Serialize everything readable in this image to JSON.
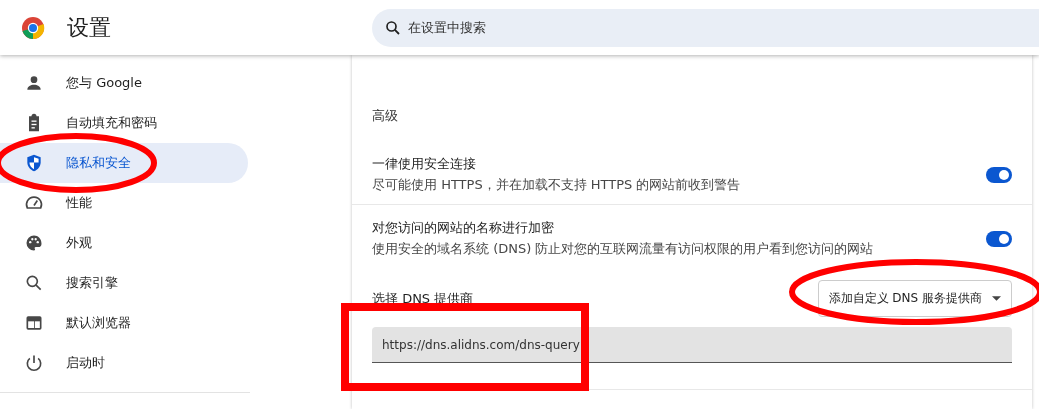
{
  "header": {
    "title": "设置",
    "search": {
      "placeholder": "在设置中搜索"
    }
  },
  "sidebar": {
    "items": [
      {
        "label": "您与 Google",
        "selected": false
      },
      {
        "label": "自动填充和密码",
        "selected": false
      },
      {
        "label": "隐私和安全",
        "selected": true
      },
      {
        "label": "性能",
        "selected": false
      },
      {
        "label": "外观",
        "selected": false
      },
      {
        "label": "搜索引擎",
        "selected": false
      },
      {
        "label": "默认浏览器",
        "selected": false
      },
      {
        "label": "启动时",
        "selected": false
      }
    ]
  },
  "content": {
    "section_title": "高级",
    "settings": [
      {
        "title": "一律使用安全连接",
        "description": "尽可能使用 HTTPS，并在加载不支持 HTTPS 的网站前收到警告",
        "on": true
      },
      {
        "title": "对您访问的网站的名称进行加密",
        "description": "使用安全的域名系统 (DNS) 防止对您的互联网流量有访问权限的用户看到您访问的网站",
        "on": true
      }
    ],
    "dns": {
      "label": "选择 DNS 提供商",
      "dropdown": "添加自定义 DNS 服务提供商",
      "value": "https://dns.alidns.com/dns-query"
    }
  },
  "annotations": [
    {
      "kind": "ellipse"
    },
    {
      "kind": "ellipse"
    },
    {
      "kind": "rectangle"
    }
  ]
}
